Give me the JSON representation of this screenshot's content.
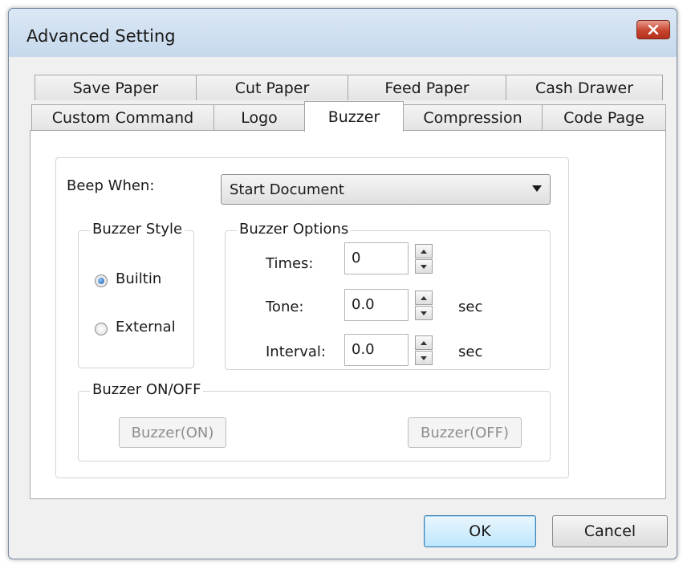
{
  "window": {
    "title": "Advanced Setting",
    "close_icon": "close-icon"
  },
  "tabs_row1": [
    "Save Paper",
    "Cut Paper",
    "Feed Paper",
    "Cash Drawer"
  ],
  "tabs_row2": [
    "Custom Command",
    "Logo",
    "Buzzer",
    "Compression",
    "Code Page"
  ],
  "active_tab": "Buzzer",
  "beep_when": {
    "label": "Beep When:",
    "value": "Start Document",
    "icon": "chevron-down-icon"
  },
  "buzzer_style": {
    "legend": "Buzzer Style",
    "options": [
      "Builtin",
      "External"
    ],
    "selected": "Builtin"
  },
  "buzzer_options": {
    "legend": "Buzzer Options",
    "times_label": "Times:",
    "times_value": "0",
    "tone_label": "Tone:",
    "tone_value": "0.0",
    "tone_unit": "sec",
    "interval_label": "Interval:",
    "interval_value": "0.0",
    "interval_unit": "sec"
  },
  "buzzer_onoff": {
    "legend": "Buzzer ON/OFF",
    "on_label": "Buzzer(ON)",
    "off_label": "Buzzer(OFF)"
  },
  "footer": {
    "ok_label": "OK",
    "cancel_label": "Cancel"
  },
  "colors": {
    "close_button": "#c8452f",
    "default_button_border": "#3c7fb1",
    "radio_dot": "#1e5fb0",
    "frame": "#cfe0f0"
  }
}
